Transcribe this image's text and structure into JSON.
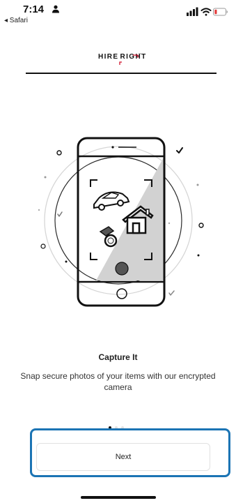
{
  "status_bar": {
    "time": "7:14",
    "back_app": "◂ Safari",
    "battery_color": "#e23b3b"
  },
  "brand": {
    "left": "HIRE",
    "right": "RIGHT",
    "trademark": "TM",
    "accent_color": "#d0112b"
  },
  "onboarding": {
    "illustration_icons": [
      "phone-icon",
      "car-icon",
      "house-icon",
      "ring-icon",
      "checkmark-icon"
    ],
    "title": "Capture It",
    "subtitle": "Snap secure photos of your items with our encrypted camera",
    "page_indicator": {
      "current": 1,
      "total": 3
    }
  },
  "actions": {
    "next_label": "Next",
    "focus_color": "#1b74b4"
  }
}
